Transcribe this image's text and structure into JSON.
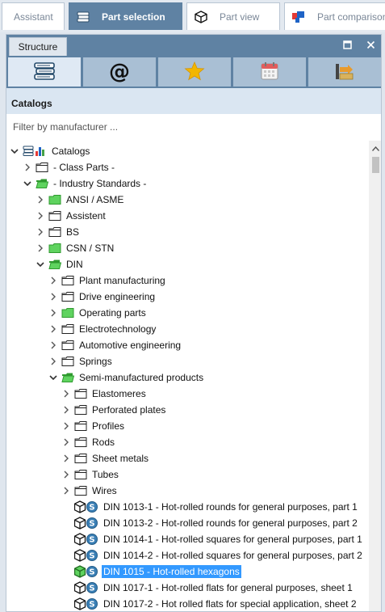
{
  "top_tabs": [
    {
      "label": "Assistant",
      "icon": "none"
    },
    {
      "label": "Part selection",
      "icon": "catalog-books-icon"
    },
    {
      "label": "Part view",
      "icon": "cube-outline-icon"
    },
    {
      "label": "Part comparison",
      "icon": "compare-icon"
    }
  ],
  "panel": {
    "tab_label": "Structure",
    "maximize_glyph": "□",
    "close_glyph": "✕"
  },
  "toolbar": {
    "buttons": [
      {
        "icon": "catalog-books-icon",
        "active": true
      },
      {
        "icon": "at-sign-icon",
        "glyph": "@"
      },
      {
        "icon": "star-icon"
      },
      {
        "icon": "calendar-icon"
      },
      {
        "icon": "export-icon"
      }
    ]
  },
  "catalogs_header": "Catalogs",
  "filter": {
    "placeholder": "Filter by manufacturer ...",
    "value": ""
  },
  "tree": [
    {
      "level": 0,
      "expander": "open",
      "icon": "catalog-root-icon",
      "label": "Catalogs"
    },
    {
      "level": 1,
      "expander": "closed",
      "icon": "folder-outline",
      "label": "- Class Parts -"
    },
    {
      "level": 1,
      "expander": "open",
      "icon": "folder-green-open",
      "label": "- Industry Standards -"
    },
    {
      "level": 2,
      "expander": "closed",
      "icon": "folder-green",
      "label": "ANSI / ASME"
    },
    {
      "level": 2,
      "expander": "closed",
      "icon": "folder-outline",
      "label": "Assistent"
    },
    {
      "level": 2,
      "expander": "closed",
      "icon": "folder-outline",
      "label": "BS"
    },
    {
      "level": 2,
      "expander": "closed",
      "icon": "folder-green",
      "label": "CSN / STN"
    },
    {
      "level": 2,
      "expander": "open",
      "icon": "folder-green-open",
      "label": "DIN"
    },
    {
      "level": 3,
      "expander": "closed",
      "icon": "folder-outline",
      "label": "Plant manufacturing"
    },
    {
      "level": 3,
      "expander": "closed",
      "icon": "folder-outline",
      "label": "Drive engineering"
    },
    {
      "level": 3,
      "expander": "closed",
      "icon": "folder-green",
      "label": "Operating parts"
    },
    {
      "level": 3,
      "expander": "closed",
      "icon": "folder-outline",
      "label": "Electrotechnology"
    },
    {
      "level": 3,
      "expander": "closed",
      "icon": "folder-outline",
      "label": "Automotive engineering"
    },
    {
      "level": 3,
      "expander": "closed",
      "icon": "folder-outline",
      "label": "Springs"
    },
    {
      "level": 3,
      "expander": "open",
      "icon": "folder-green-open",
      "label": "Semi-manufactured products"
    },
    {
      "level": 4,
      "expander": "closed",
      "icon": "folder-outline",
      "label": "Elastomeres"
    },
    {
      "level": 4,
      "expander": "closed",
      "icon": "folder-outline",
      "label": "Perforated plates"
    },
    {
      "level": 4,
      "expander": "closed",
      "icon": "folder-outline",
      "label": "Profiles"
    },
    {
      "level": 4,
      "expander": "closed",
      "icon": "folder-outline",
      "label": "Rods"
    },
    {
      "level": 4,
      "expander": "closed",
      "icon": "folder-outline",
      "label": "Sheet metals"
    },
    {
      "level": 4,
      "expander": "closed",
      "icon": "folder-outline",
      "label": "Tubes"
    },
    {
      "level": 4,
      "expander": "closed",
      "icon": "folder-outline",
      "label": "Wires"
    },
    {
      "level": 4,
      "expander": "none",
      "icon": "part",
      "label": "DIN 1013-1 - Hot-rolled rounds for general purposes, part 1"
    },
    {
      "level": 4,
      "expander": "none",
      "icon": "part",
      "label": "DIN 1013-2 - Hot-rolled rounds for general purposes, part 2"
    },
    {
      "level": 4,
      "expander": "none",
      "icon": "part",
      "label": "DIN 1014-1 - Hot-rolled squares for general purposes, part 1"
    },
    {
      "level": 4,
      "expander": "none",
      "icon": "part",
      "label": "DIN 1014-2 - Hot-rolled squares for general purposes, part 2"
    },
    {
      "level": 4,
      "expander": "none",
      "icon": "part-green",
      "label": "DIN 1015 - Hot-rolled hexagons",
      "selected": true
    },
    {
      "level": 4,
      "expander": "none",
      "icon": "part",
      "label": "DIN 1017-1 - Hot-rolled flats for general purposes, sheet 1"
    },
    {
      "level": 4,
      "expander": "none",
      "icon": "part",
      "label": "DIN 1017-2 - Hot rolled flats for special application, sheet 2"
    }
  ],
  "colors": {
    "header_blue": "#5f82a3",
    "selection_blue": "#3399ff",
    "folder_green": "#5fd35f",
    "folder_green_dark": "#2f9a2f",
    "star_gold": "#f2b600",
    "part_badge_blue": "#3a7fb5"
  }
}
